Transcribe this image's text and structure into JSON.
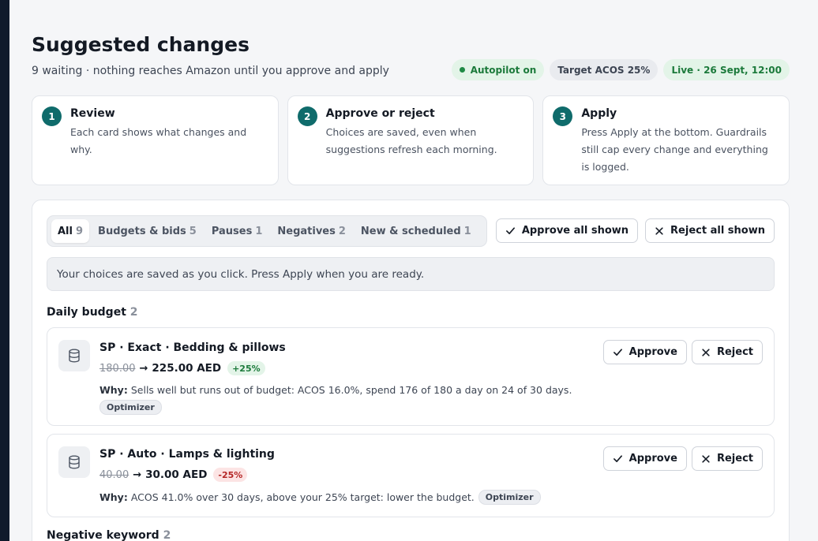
{
  "header": {
    "title": "Suggested changes",
    "subtitle": "9 waiting · nothing reaches Amazon until you approve and apply",
    "status_pills": {
      "autopilot": "Autopilot on",
      "target": "Target ACOS 25%",
      "live": "Live · 26 Sept, 12:00"
    }
  },
  "steps": [
    {
      "number": "1",
      "title": "Review",
      "text": "Each card shows what changes and why."
    },
    {
      "number": "2",
      "title": "Approve or reject",
      "text": "Choices are saved, even when suggestions refresh each morning."
    },
    {
      "number": "3",
      "title": "Apply",
      "text": "Press Apply at the bottom. Guardrails still cap every change and everything is logged."
    }
  ],
  "filters": {
    "tabs": [
      {
        "label": "All",
        "count": "9"
      },
      {
        "label": "Budgets & bids",
        "count": "5"
      },
      {
        "label": "Pauses",
        "count": "1"
      },
      {
        "label": "Negatives",
        "count": "2"
      },
      {
        "label": "New & scheduled",
        "count": "1"
      }
    ],
    "active_tab": "All",
    "approve_all_label": "Approve all shown",
    "reject_all_label": "Reject all shown"
  },
  "notice": "Your choices are saved as you click. Press Apply when you are ready.",
  "sections": [
    {
      "title": "Daily budget",
      "count": "2",
      "cards": [
        {
          "title": "SP · Exact · Bedding & pillows",
          "old_value": "180.00",
          "new_value": "225.00 AED",
          "delta": "+25%",
          "why_label": "Why:",
          "why": "Sells well but runs out of budget: ACOS 16.0%, spend 176 of 180 a day on 24 of 30 days.",
          "source": "Optimizer",
          "approve_label": "Approve",
          "reject_label": "Reject"
        },
        {
          "title": "SP · Auto · Lamps & lighting",
          "old_value": "40.00",
          "new_value": "30.00 AED",
          "delta": "-25%",
          "why_label": "Why:",
          "why": "ACOS 41.0% over 30 days, above your 25% target: lower the budget.",
          "source": "Optimizer",
          "approve_label": "Approve",
          "reject_label": "Reject"
        }
      ]
    },
    {
      "title": "Negative keyword",
      "count": "2"
    }
  ],
  "icons": {
    "card_icon": "database-icon",
    "approve_icon": "check-icon",
    "reject_icon": "close-icon"
  },
  "colors": {
    "accent": "#0f6b6b",
    "positive": "#1c7a3b",
    "negative": "#b42626",
    "sidebar": "#0f1a2b"
  }
}
